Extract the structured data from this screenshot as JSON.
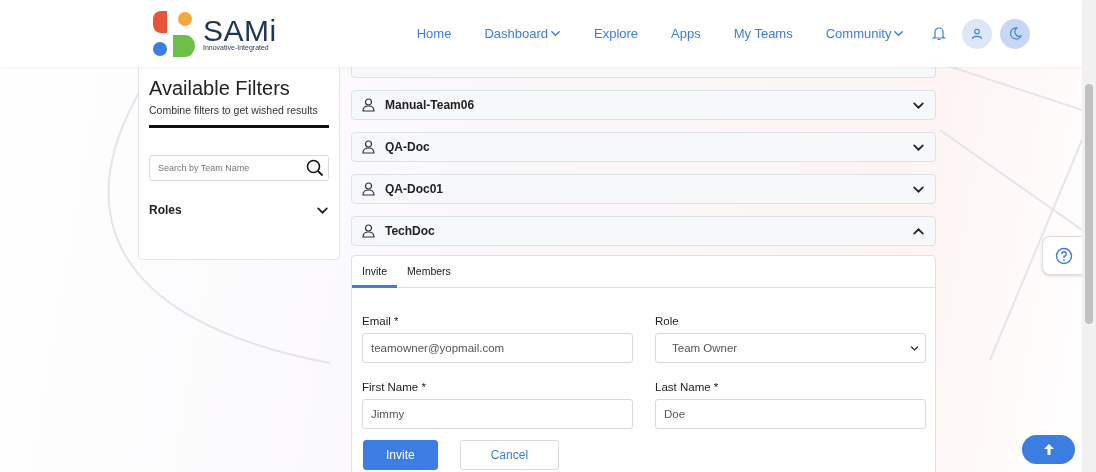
{
  "header": {
    "logo_title": "SAMi",
    "logo_tagline": "Innovative-Integrated",
    "nav": [
      {
        "label": "Home",
        "dropdown": false
      },
      {
        "label": "Dashboard",
        "dropdown": true
      },
      {
        "label": "Explore",
        "dropdown": false
      },
      {
        "label": "Apps",
        "dropdown": false
      },
      {
        "label": "My Teams",
        "dropdown": false
      },
      {
        "label": "Community",
        "dropdown": true
      }
    ]
  },
  "filters": {
    "title": "Available Filters",
    "subtitle": "Combine filters to get wished results",
    "search": {
      "placeholder": "Search by Team Name"
    },
    "sections": [
      {
        "label": "Roles",
        "expanded": false
      }
    ]
  },
  "teams": [
    {
      "name": "Manual-Team06",
      "expanded": false
    },
    {
      "name": "QA-Doc",
      "expanded": false
    },
    {
      "name": "QA-Doc01",
      "expanded": false
    },
    {
      "name": "TechDoc",
      "expanded": true
    }
  ],
  "tabs": [
    {
      "label": "Invite",
      "selected": true
    },
    {
      "label": "Members",
      "selected": false
    }
  ],
  "form": [
    {
      "kind": "text",
      "label": "Email *",
      "value": "teamowner@yopmail.com"
    },
    {
      "kind": "select",
      "label": "Role",
      "value": "Team Owner"
    },
    {
      "kind": "text",
      "label": "First Name *",
      "value": "Jimmy"
    },
    {
      "kind": "text",
      "label": "Last Name *",
      "value": "Doe"
    }
  ],
  "buttons": [
    {
      "kind": "primary",
      "label": "Invite"
    },
    {
      "kind": "secondary",
      "label": "Cancel"
    }
  ]
}
